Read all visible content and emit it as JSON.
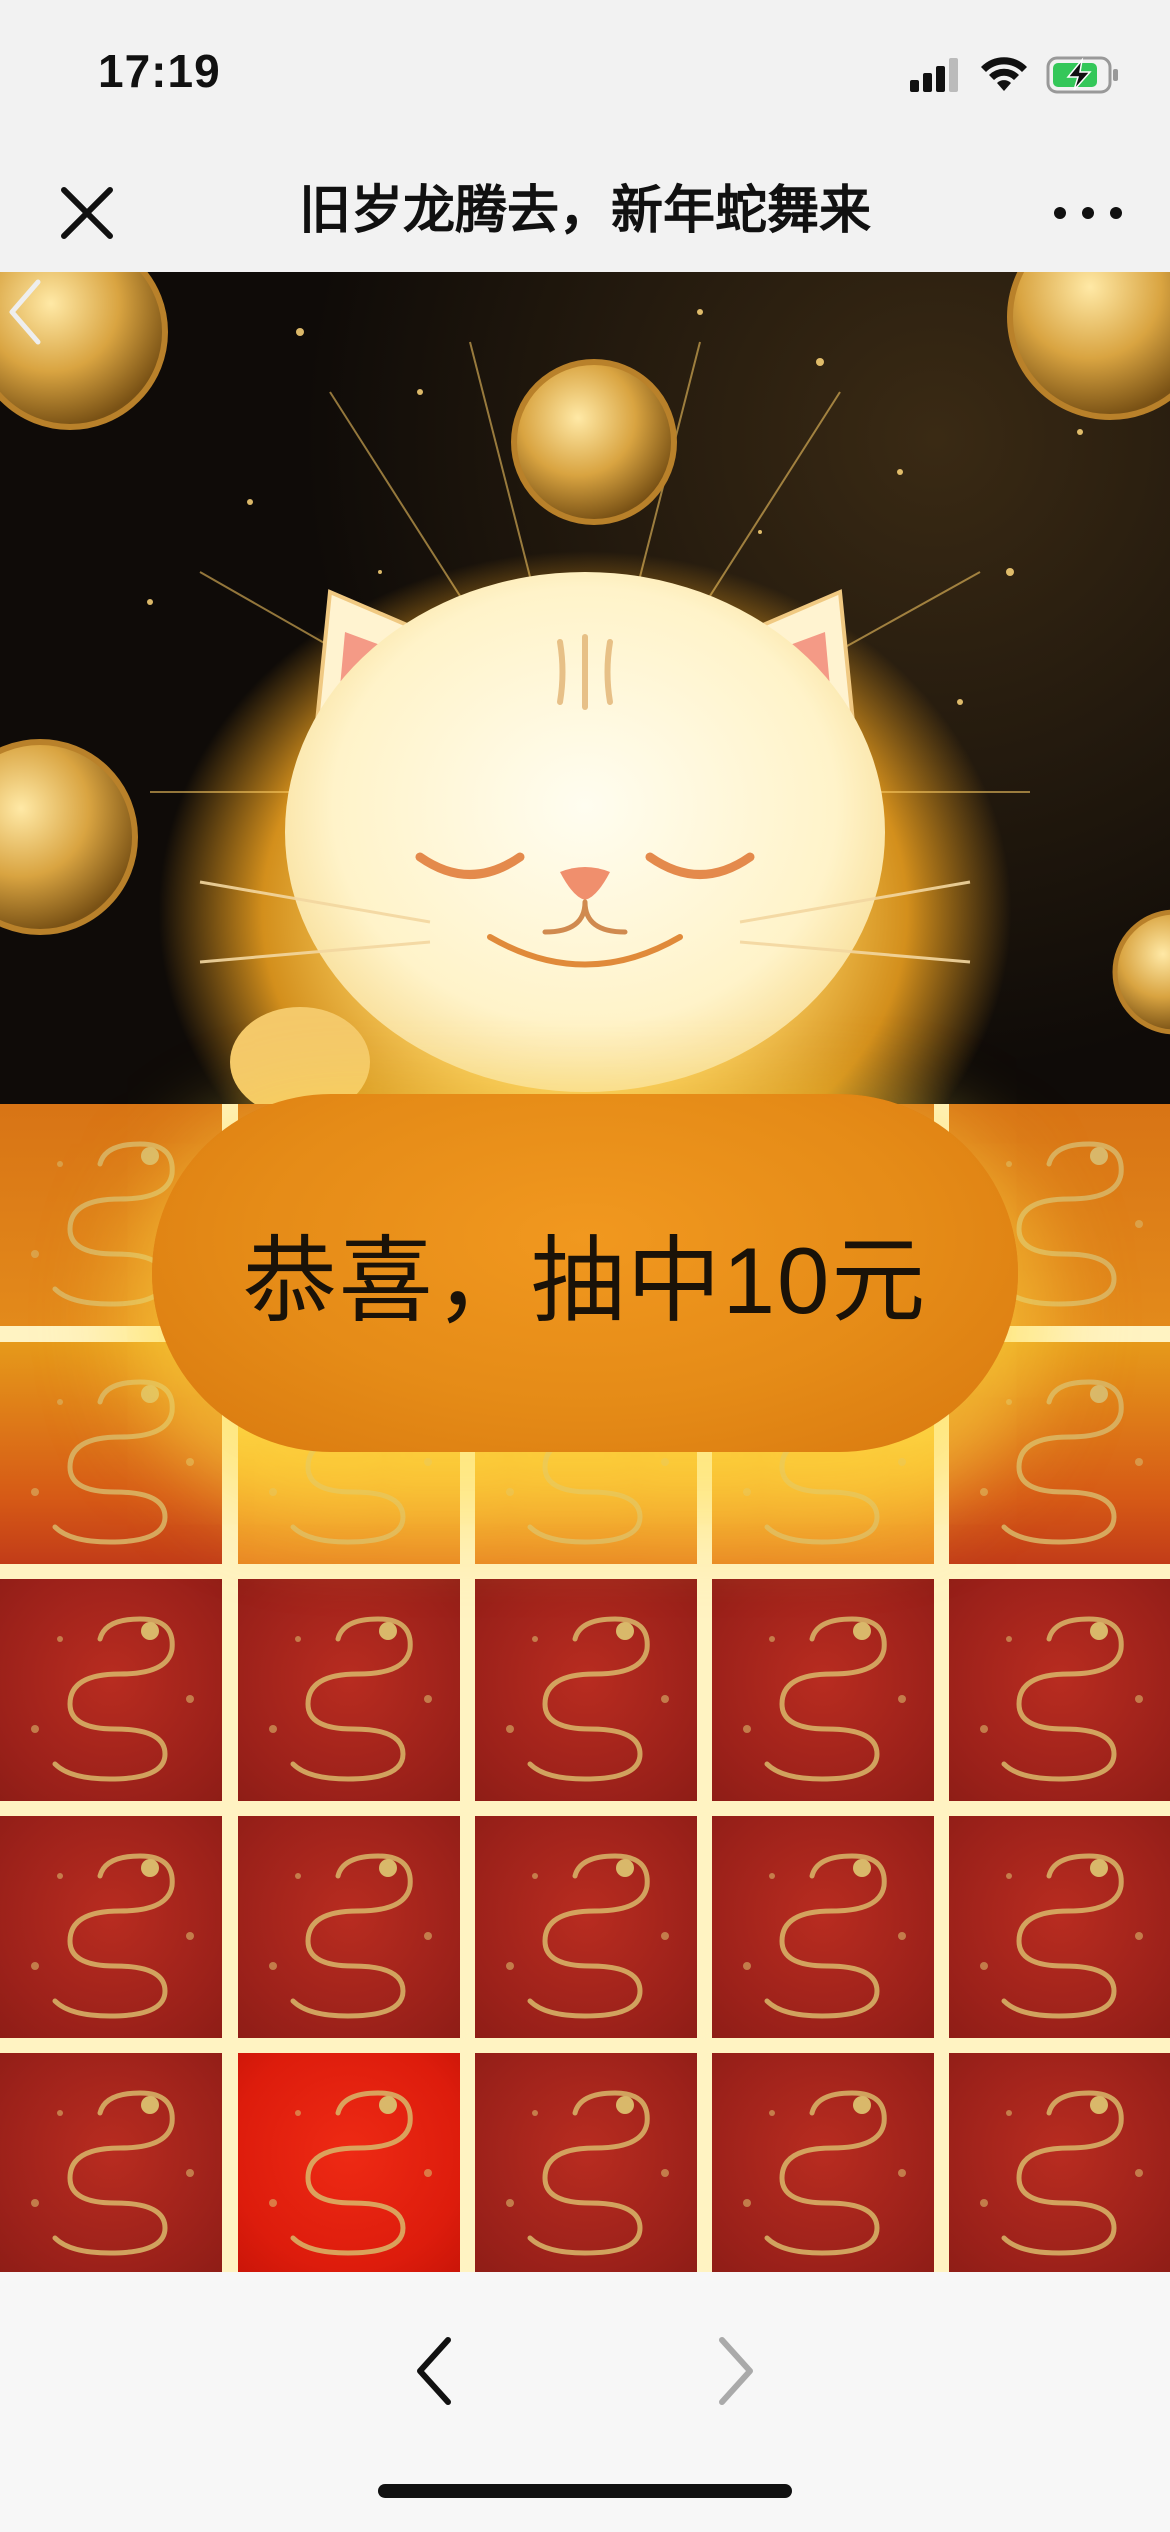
{
  "status_bar": {
    "time": "17:19",
    "icons": [
      "signal-icon",
      "wifi-icon",
      "battery-charging-icon"
    ],
    "battery_color": "#34c759"
  },
  "nav_bar": {
    "title": "旧岁龙腾去，新年蛇舞来",
    "close_icon": "close-icon",
    "more_icon": "more-icon"
  },
  "hero": {
    "subject": "lucky cat with gold coins",
    "back_icon": "chevron-left-icon"
  },
  "lottery": {
    "result_text": "恭喜，抽中10元",
    "grid_rows": 5,
    "grid_cols": 5,
    "tile_icon": "snake-icon",
    "highlighted_tile": 21,
    "tile_color": "#9c211a",
    "highlight_color": "#dd1c0c"
  },
  "bottom_bar": {
    "back_icon": "chevron-left-icon",
    "forward_icon": "chevron-right-icon",
    "forward_enabled": false
  }
}
